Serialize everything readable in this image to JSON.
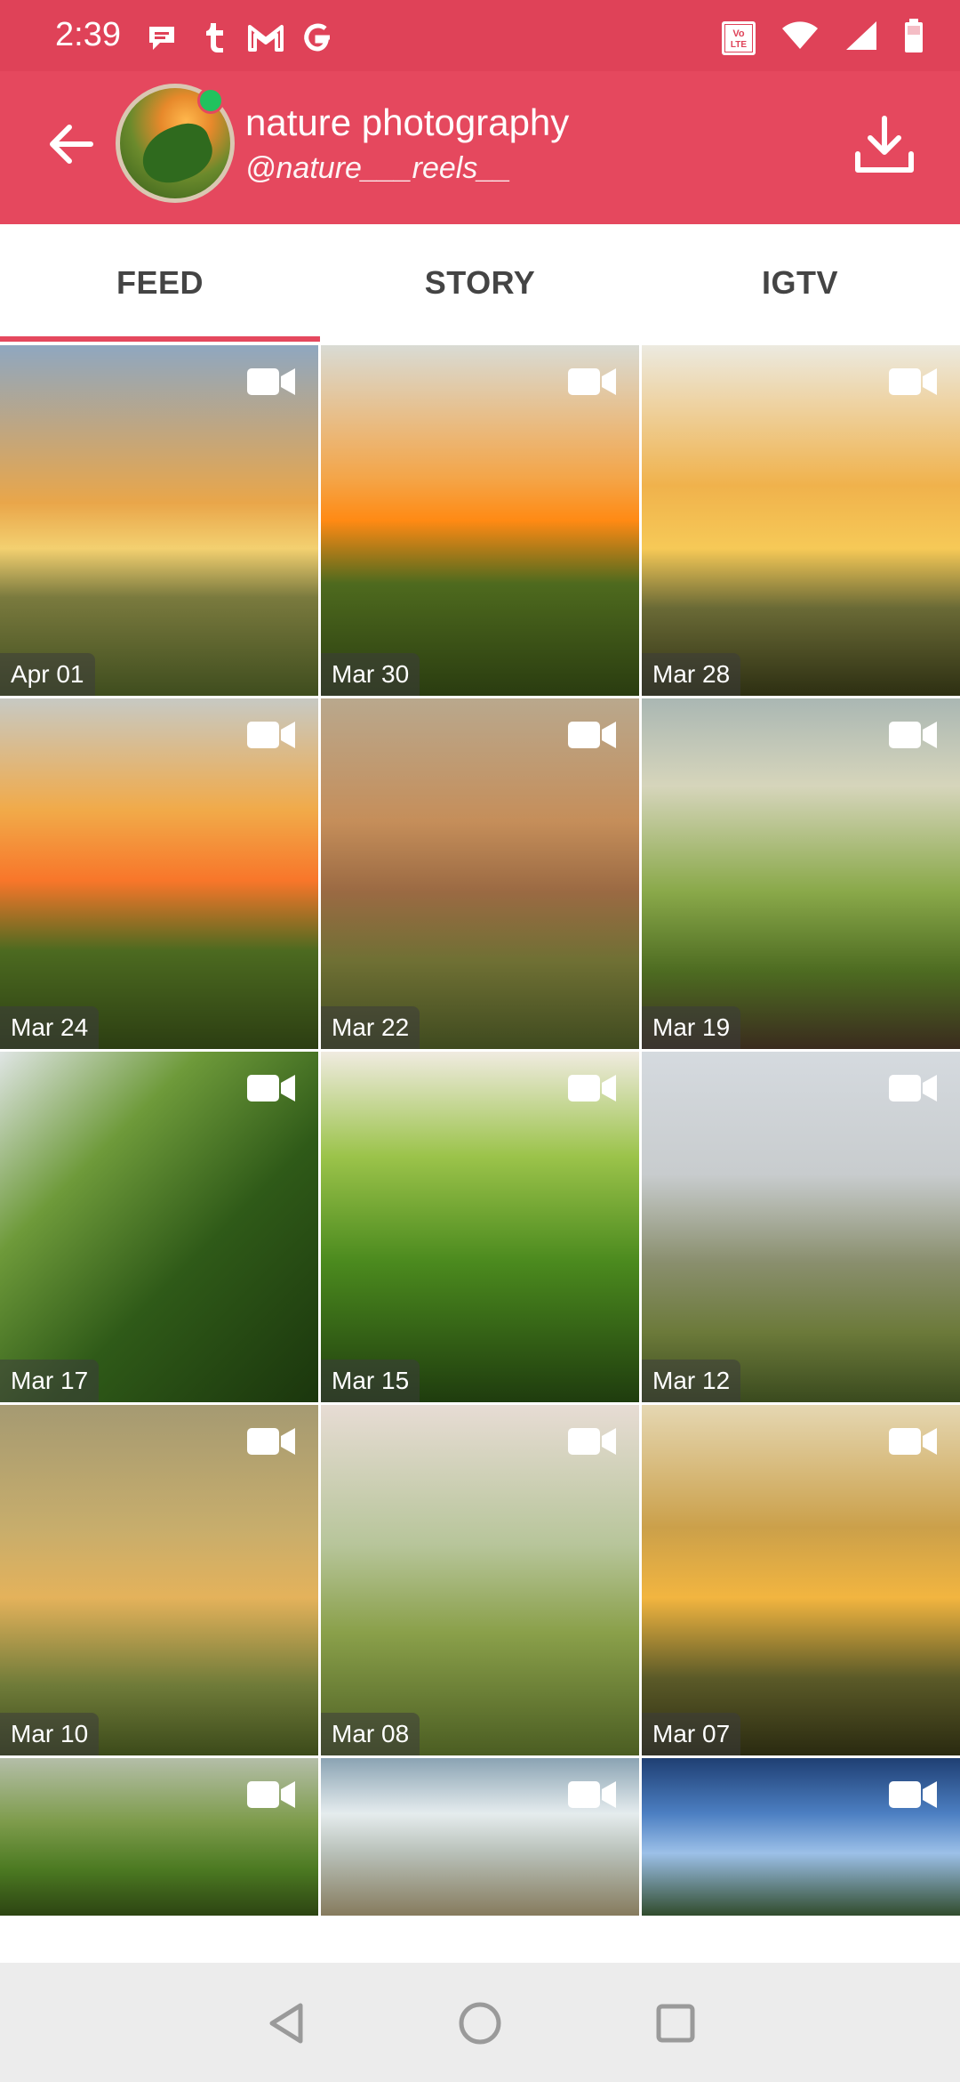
{
  "status_bar": {
    "time": "2:39",
    "notifications": [
      "chat-bubble-icon",
      "tumblr-icon",
      "gmail-icon",
      "google-icon"
    ],
    "right_icons": [
      "volte-icon",
      "wifi-icon",
      "signal-icon",
      "battery-icon"
    ],
    "volte_text": "Vo LTE"
  },
  "app_bar": {
    "name": "nature photography",
    "handle": "@nature___reels__",
    "online_indicator_color": "#21c25e"
  },
  "tabs": [
    {
      "label": "FEED",
      "active": true
    },
    {
      "label": "STORY",
      "active": false
    },
    {
      "label": "IGTV",
      "active": false
    }
  ],
  "feed": [
    {
      "date": "Apr 01",
      "type": "video"
    },
    {
      "date": "Mar 30",
      "type": "video"
    },
    {
      "date": "Mar 28",
      "type": "video"
    },
    {
      "date": "Mar 24",
      "type": "video"
    },
    {
      "date": "Mar 22",
      "type": "video"
    },
    {
      "date": "Mar 19",
      "type": "video"
    },
    {
      "date": "Mar 17",
      "type": "video"
    },
    {
      "date": "Mar 15",
      "type": "video"
    },
    {
      "date": "Mar 12",
      "type": "video"
    },
    {
      "date": "Mar 10",
      "type": "video"
    },
    {
      "date": "Mar 08",
      "type": "video"
    },
    {
      "date": "Mar 07",
      "type": "video"
    },
    {
      "date": "",
      "type": "video"
    },
    {
      "date": "",
      "type": "video"
    },
    {
      "date": "",
      "type": "video"
    }
  ],
  "nav_bar": [
    "back-icon",
    "home-icon",
    "recents-icon"
  ],
  "colors": {
    "accent": "#e5485e",
    "status_bar": "#df4258",
    "tab_text": "#444444"
  }
}
